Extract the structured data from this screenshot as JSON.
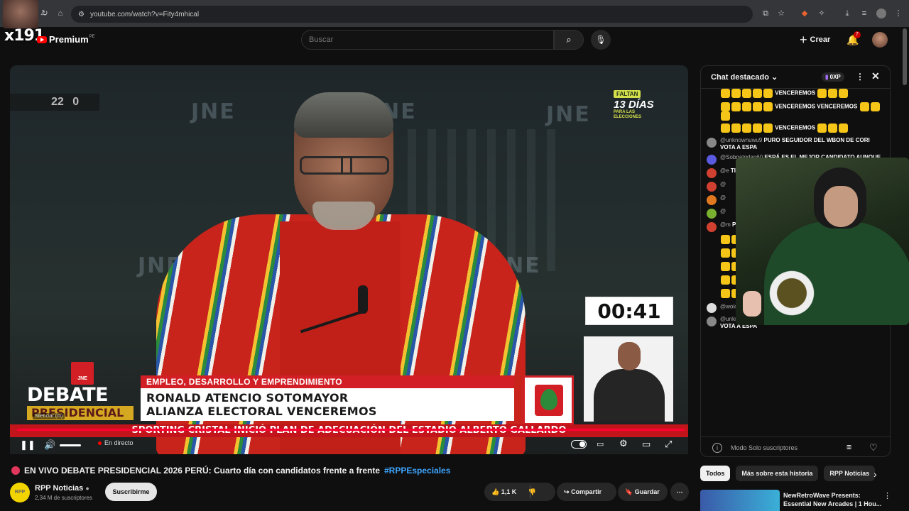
{
  "browser": {
    "url": "youtube.com/watch?v=Fity4mhical"
  },
  "overlay": {
    "streamer_tag": "x191"
  },
  "header": {
    "brand": "Premium",
    "brand_region": "PE",
    "search_placeholder": "Buscar",
    "create_label": "Crear",
    "notification_count": "7"
  },
  "video": {
    "scoreboard": "22",
    "scoreboard_dot": "0",
    "watermark": "JNE",
    "countdown_badge": "FALTAN",
    "countdown_days": "13 DÍAS",
    "countdown_sub": "PARA LAS ELECCIONES",
    "timer": "00:41",
    "jne_badge": "JNE",
    "debate_word": "DEBATE",
    "presidencial_word": "PRESIDENCIAL",
    "mute_tooltip": "Silenciar (m)",
    "lower_third_category": "EMPLEO, DESARROLLO Y EMPRENDIMIENTO",
    "lower_third_name": "RONALD ATENCIO SOTOMAYOR",
    "lower_third_party": "ALIANZA ELECTORAL VENCEREMOS",
    "ticker": "SPORTING CRISTAL INICIÓ PLAN DE ADECUACIÓN DEL ESTADIO ALBERTO GALLARDO",
    "live_label": "En directo"
  },
  "chat": {
    "header": "Chat destacado",
    "xp": "0XP",
    "messages": [
      {
        "user": "",
        "text": "VENCEREMOS",
        "avatar_color": "#444"
      },
      {
        "user": "",
        "text": "VENCEREMOS",
        "text2": "VENCEREMOS",
        "avatar_color": "#444"
      },
      {
        "user": "",
        "text": "VENCEREMOS",
        "avatar_color": "#444"
      },
      {
        "user": "@unknownuwu9",
        "text": "PURO SEGUIDOR DEL WBON DE CORI VOTA A ESPA",
        "avatar_color": "#888"
      },
      {
        "user": "@Sobnatgdan60",
        "text": "ESPÁ ES EL MEJOR CANDIDATO AUNQUE",
        "avatar_color": "#5a5ae0"
      },
      {
        "user": "@e",
        "text": "TI",
        "avatar_color": "#d04030"
      },
      {
        "user": "@",
        "text": "",
        "avatar_color": "#d04030"
      },
      {
        "user": "@",
        "text": "",
        "avatar_color": "#e07820"
      },
      {
        "user": "@",
        "text": "",
        "avatar_color": "#7ab030"
      },
      {
        "user": "@m",
        "text": "PRESID",
        "avatar_color": "#d04030"
      },
      {
        "user": "",
        "text": "VENCEREMOS",
        "avatar_color": "#444"
      },
      {
        "user": "",
        "text": "VENCEREMOS",
        "avatar_color": "#444"
      },
      {
        "user": "",
        "text": "VENCEREMOS",
        "avatar_color": "#444"
      },
      {
        "user": "",
        "text": "VENCEREMOS",
        "avatar_color": "#444"
      },
      {
        "user": "",
        "text": "VENCEREMOS",
        "avatar_color": "#444"
      },
      {
        "user": "@wolototem",
        "text": "",
        "avatar_color": "#ddd"
      },
      {
        "user": "@unknownuwu9",
        "text": "PURO SEGUIDOR DEL WBON DE CORI VOTA A ESPA",
        "avatar_color": "#888"
      }
    ],
    "footer": "Modo Solo suscriptores"
  },
  "below": {
    "title": "EN VIVO DEBATE PRESIDENCIAL 2026 PERÚ: Cuarto día con candidatos frente a frente",
    "hashtag": "#RPPEspeciales",
    "channel_name": "RPP Noticias",
    "channel_subs": "2,34 M de suscriptores",
    "channel_avatar": "RPP",
    "subscribe": "Suscribirme",
    "likes": "1,1 K",
    "share": "Compartir",
    "save": "Guardar"
  },
  "sidebar": {
    "chips": [
      "Todos",
      "Más sobre esta historia",
      "RPP Noticias"
    ],
    "reco_title_1": "NewRetroWave Presents:",
    "reco_title_2": "Essential New Arcades | 1 Hou..."
  }
}
